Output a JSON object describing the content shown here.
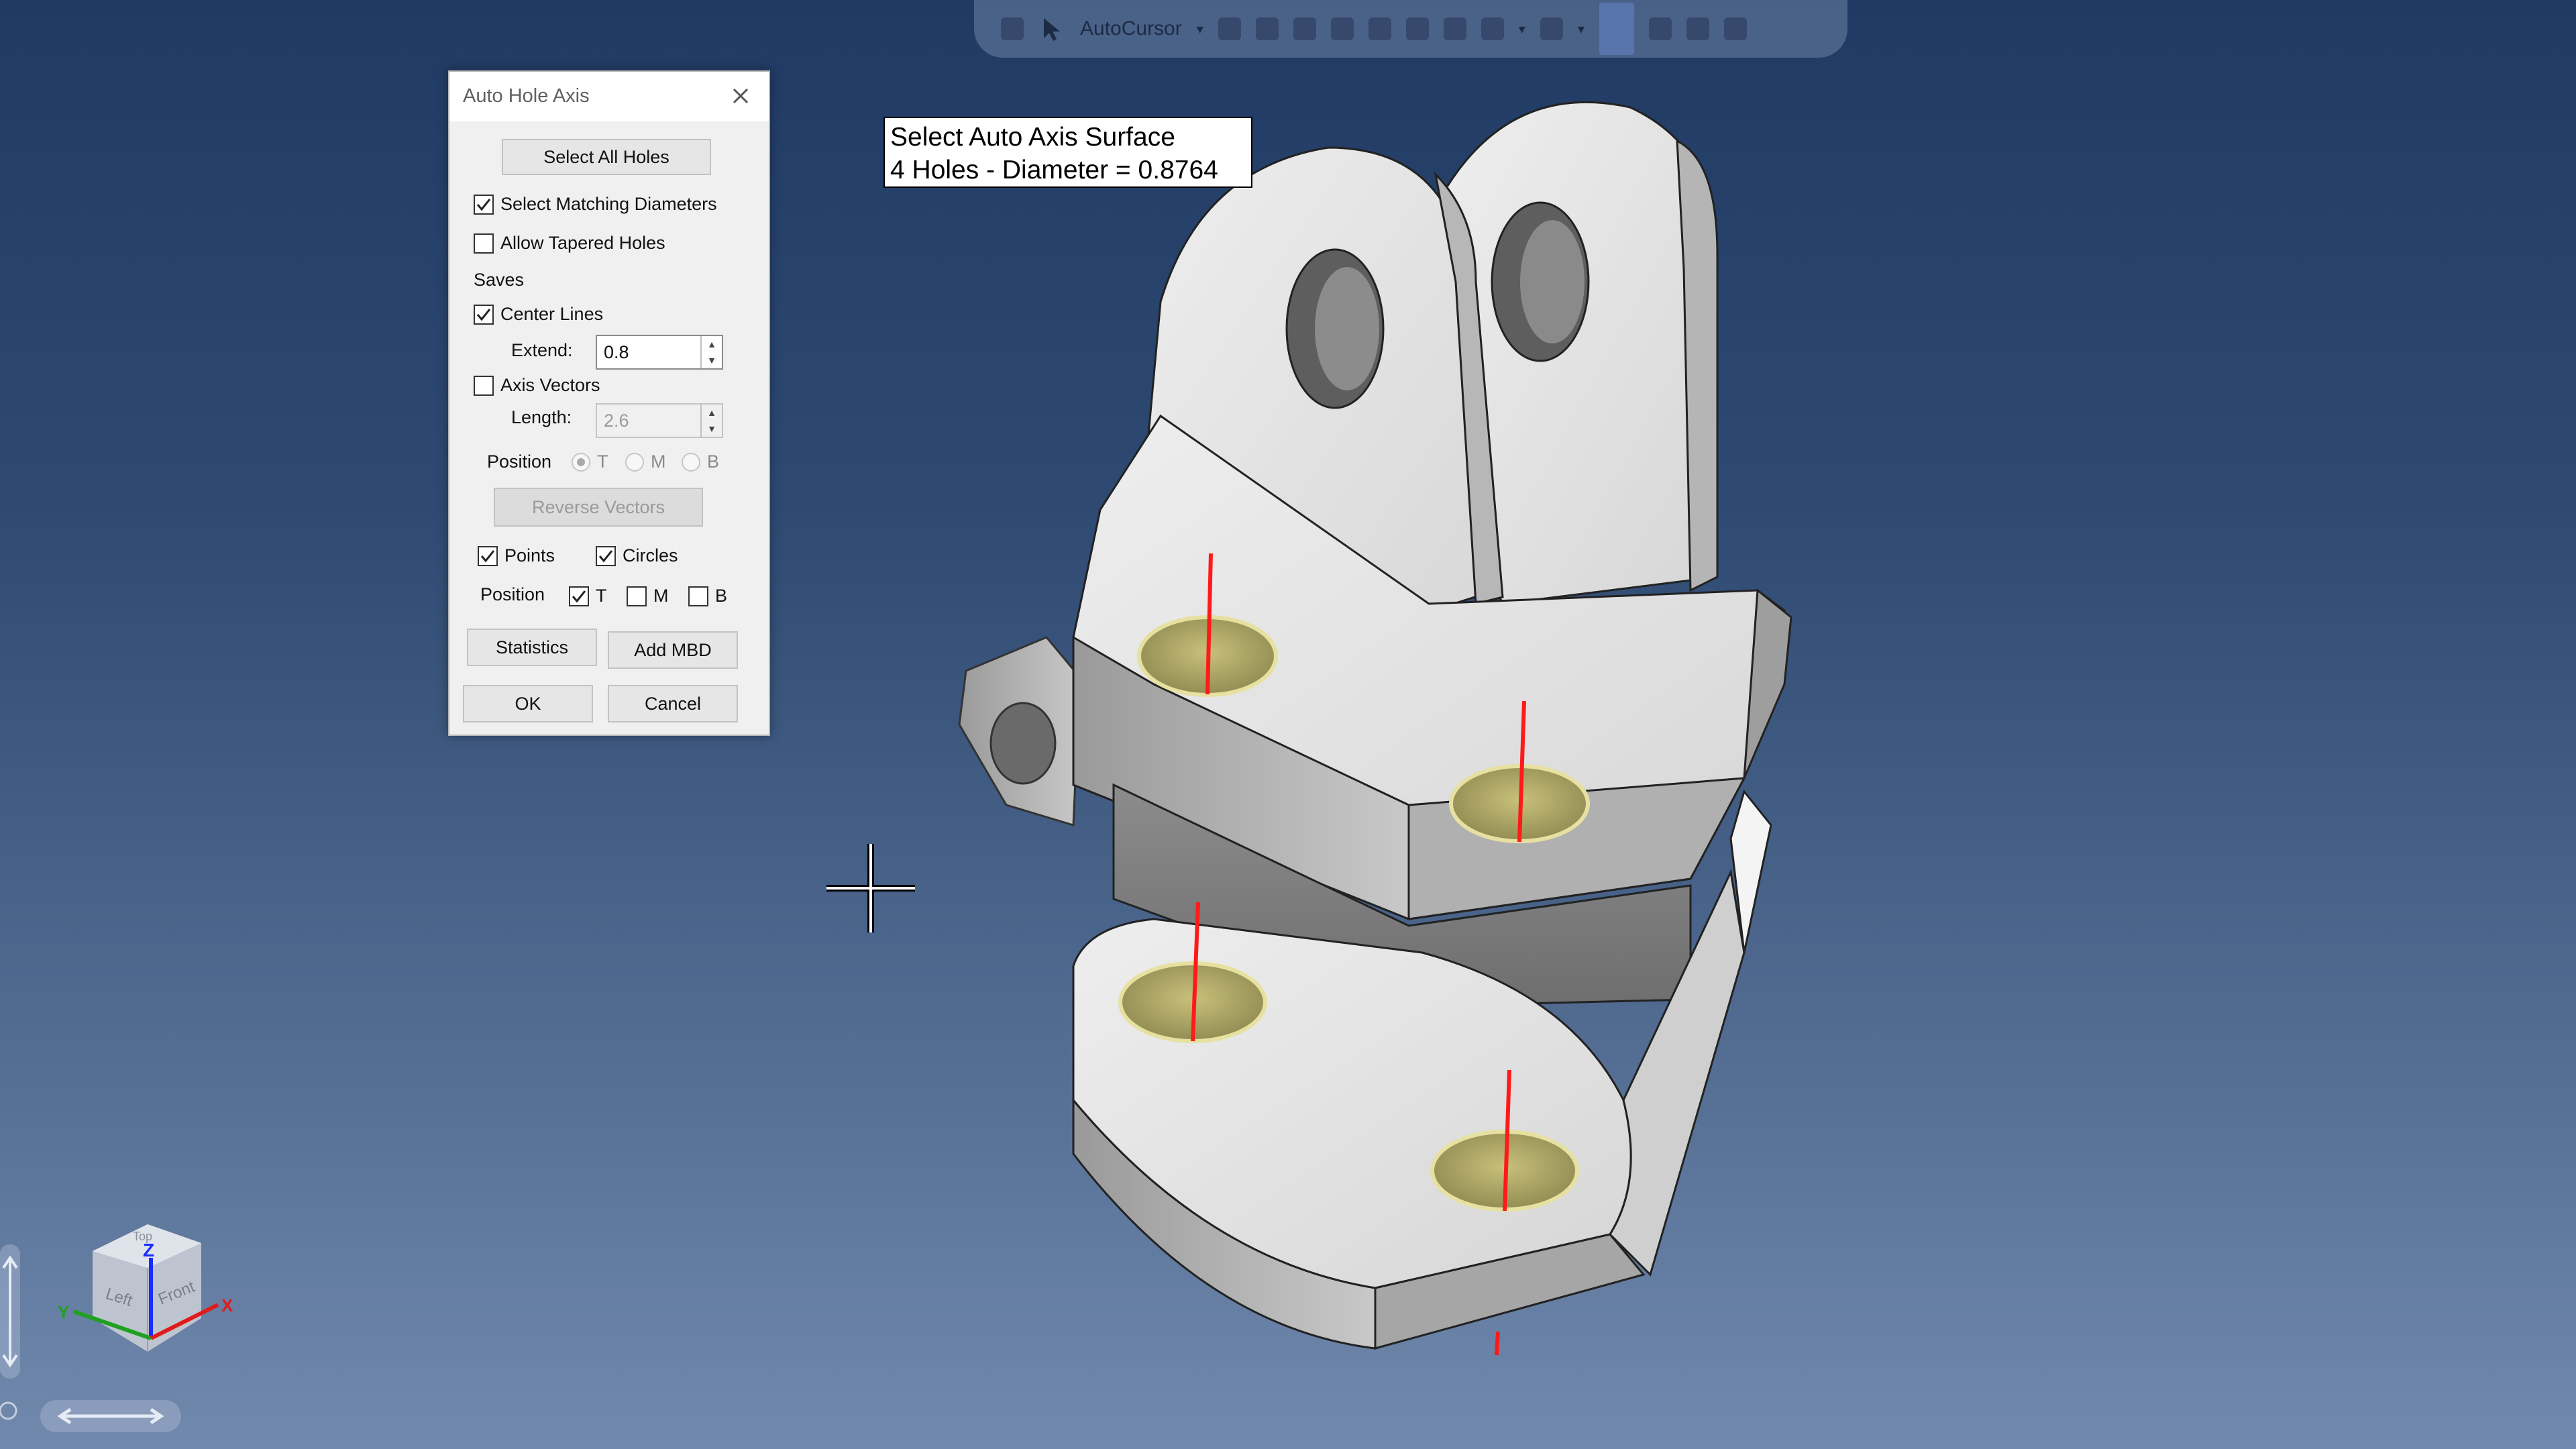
{
  "toolbar": {
    "autocursor_label": "AutoCursor",
    "icons": [
      "print-icon",
      "select-arrow-icon",
      "xyz-icon",
      "snap-icon",
      "pointer-icon",
      "filter-icon",
      "layers-icon",
      "group-icon",
      "shade-icon",
      "wireframe-icon",
      "grid-icon",
      "active-mode-icon",
      "rotate-icon",
      "refresh-icon",
      "undo-icon"
    ]
  },
  "dialog": {
    "title": "Auto Hole Axis",
    "select_all_holes": "Select All Holes",
    "select_matching_diameters": {
      "label": "Select Matching Diameters",
      "checked": true
    },
    "allow_tapered_holes": {
      "label": "Allow Tapered Holes",
      "checked": false
    },
    "saves_label": "Saves",
    "center_lines": {
      "label": "Center Lines",
      "checked": true
    },
    "extend": {
      "label": "Extend:",
      "value": "0.8"
    },
    "axis_vectors": {
      "label": "Axis Vectors",
      "checked": false
    },
    "length": {
      "label": "Length:",
      "value": "2.6"
    },
    "vector_position": {
      "label": "Position",
      "options": [
        "T",
        "M",
        "B"
      ],
      "selected": "T"
    },
    "reverse_vectors": "Reverse Vectors",
    "points": {
      "label": "Points",
      "checked": true
    },
    "circles": {
      "label": "Circles",
      "checked": true
    },
    "point_position": {
      "label": "Position",
      "t": {
        "label": "T",
        "checked": true
      },
      "m": {
        "label": "M",
        "checked": false
      },
      "b": {
        "label": "B",
        "checked": false
      }
    },
    "statistics": "Statistics",
    "add_mbd": "Add MBD",
    "ok": "OK",
    "cancel": "Cancel"
  },
  "info": {
    "line1": "Select Auto Axis Surface",
    "line2": "4 Holes - Diameter = 0.8764"
  },
  "viewcube": {
    "z": "Z",
    "y": "Y",
    "x": "X",
    "left_face": "Left",
    "front_face": "Front",
    "top_face": "Top"
  },
  "colors": {
    "background_top": "#203a63",
    "background_bottom": "#7189ad",
    "hole_fill": "#e6e1a0",
    "axis_line": "#ff1a1a",
    "part_face": "#e2e2e2"
  }
}
